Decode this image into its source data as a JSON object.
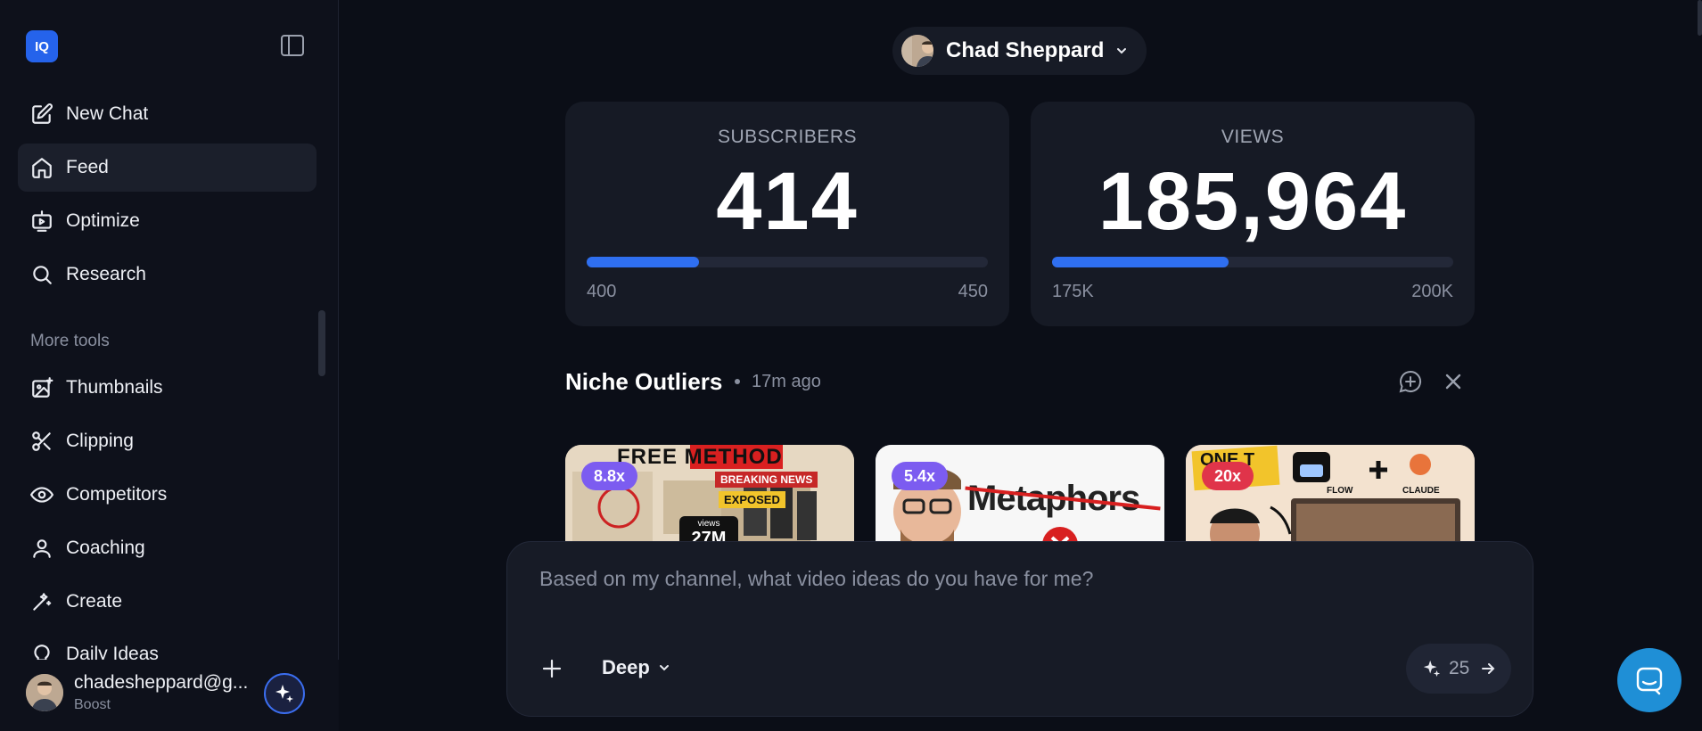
{
  "app": {
    "logo_text": "IQ"
  },
  "sidebar": {
    "items": [
      {
        "label": "New Chat",
        "icon": "edit-icon"
      },
      {
        "label": "Feed",
        "icon": "home-icon",
        "active": true
      },
      {
        "label": "Optimize",
        "icon": "optimize-icon"
      },
      {
        "label": "Research",
        "icon": "search-icon"
      }
    ],
    "more_tools_label": "More tools",
    "tools": [
      {
        "label": "Thumbnails",
        "icon": "image-icon"
      },
      {
        "label": "Clipping",
        "icon": "scissors-icon"
      },
      {
        "label": "Competitors",
        "icon": "eye-icon"
      },
      {
        "label": "Coaching",
        "icon": "user-icon"
      },
      {
        "label": "Create",
        "icon": "wand-icon"
      },
      {
        "label": "Daily Ideas",
        "icon": "bulb-icon"
      }
    ],
    "user": {
      "email": "chadesheppard@g...",
      "plan": "Boost"
    }
  },
  "header": {
    "channel_name": "Chad Sheppard"
  },
  "stats": {
    "subscribers": {
      "label": "SUBSCRIBERS",
      "value": "414",
      "min": "400",
      "max": "450",
      "progress": 0.28
    },
    "views": {
      "label": "VIEWS",
      "value": "185,964",
      "min": "175K",
      "max": "200K",
      "progress": 0.44
    }
  },
  "outliers": {
    "title": "Niche Outliers",
    "time": "17m ago",
    "cards": [
      {
        "badge": "8.8x",
        "badge_color": "#7c5cf0",
        "text_top": "FREE METHOD",
        "text_tag1": "BREAKING NEWS",
        "text_tag2": "EXPOSED",
        "text_views_label": "views",
        "text_views": "27M"
      },
      {
        "badge": "5.4x",
        "badge_color": "#7c5cf0",
        "text_word": "Metaphors"
      },
      {
        "badge": "20x",
        "badge_color": "#e0344a",
        "text_flow": "FLOW",
        "text_claude": "CLAUDE",
        "text_partial": "ONE T"
      }
    ]
  },
  "composer": {
    "placeholder": "Based on my channel, what video ideas do you have for me?",
    "mode": "Deep",
    "credits": "25"
  },
  "colors": {
    "accent": "#2f6ff0",
    "background": "#0b0e17",
    "card": "#161a25"
  }
}
